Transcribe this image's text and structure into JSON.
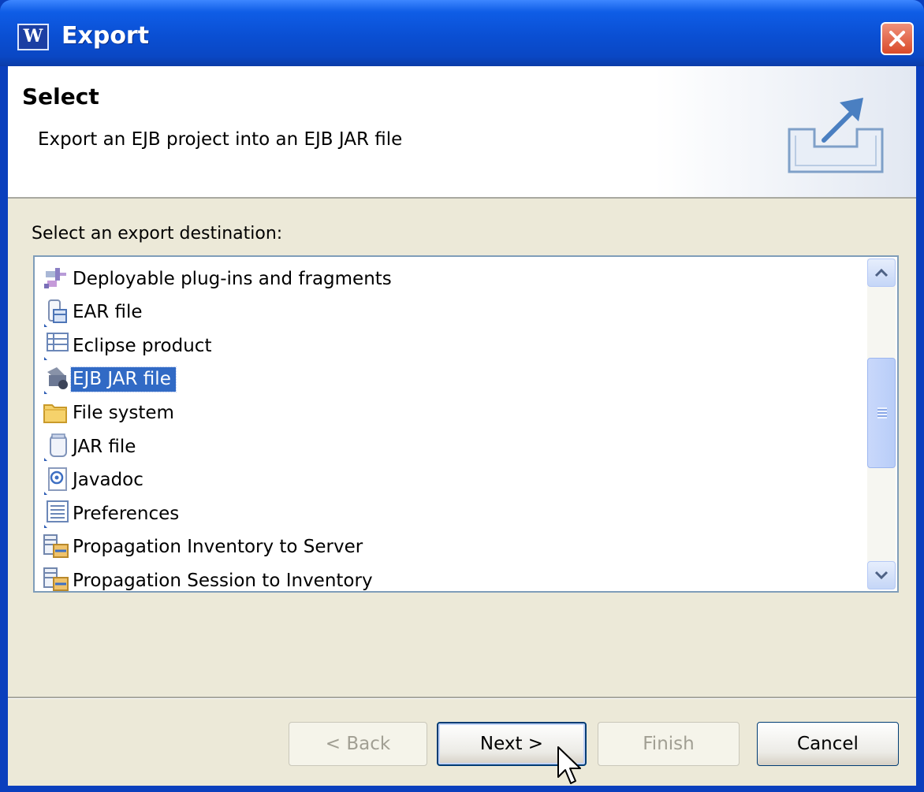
{
  "window": {
    "title": "Export",
    "app_icon_letter": "W"
  },
  "banner": {
    "title": "Select",
    "description": "Export an EJB project into an EJB JAR file",
    "icon": "export-wizard-icon"
  },
  "list_label": "Select an export destination:",
  "destinations": [
    {
      "label": "Deployable plug-ins and fragments",
      "icon": "plugin-icon",
      "selected": false
    },
    {
      "label": "EAR file",
      "icon": "ear-file-icon",
      "selected": false
    },
    {
      "label": "Eclipse product",
      "icon": "product-icon",
      "selected": false
    },
    {
      "label": "EJB JAR file",
      "icon": "ejb-jar-icon",
      "selected": true
    },
    {
      "label": "File system",
      "icon": "folder-icon",
      "selected": false
    },
    {
      "label": "JAR file",
      "icon": "jar-icon",
      "selected": false
    },
    {
      "label": "Javadoc",
      "icon": "javadoc-icon",
      "selected": false
    },
    {
      "label": "Preferences",
      "icon": "preferences-icon",
      "selected": false
    },
    {
      "label": "Propagation Inventory to Server",
      "icon": "propagation-icon",
      "selected": false
    },
    {
      "label": "Propagation Session to Inventory",
      "icon": "propagation-icon",
      "selected": false
    }
  ],
  "buttons": {
    "back": {
      "label": "< Back",
      "enabled": false
    },
    "next": {
      "label": "Next >",
      "enabled": true,
      "default": true
    },
    "finish": {
      "label": "Finish",
      "enabled": false
    },
    "cancel": {
      "label": "Cancel",
      "enabled": true
    }
  },
  "colors": {
    "title_bar": "#0a4fd3",
    "selection": "#316ac5",
    "dialog_bg": "#ece9d8"
  }
}
